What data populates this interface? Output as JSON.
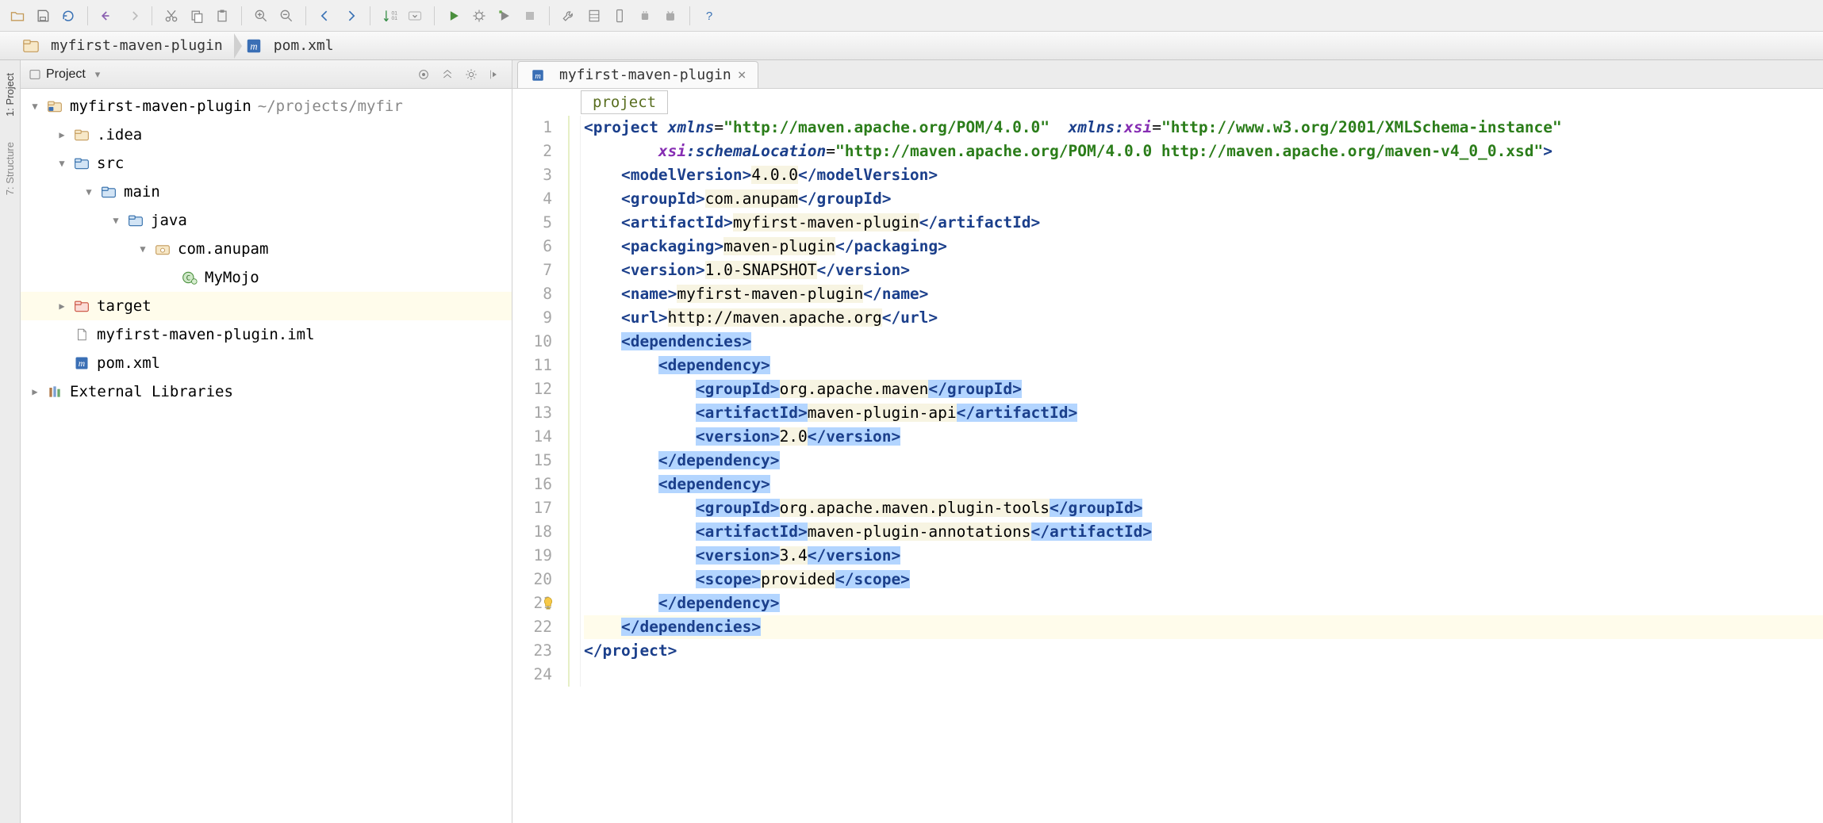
{
  "toolbar": {
    "buttons": [
      "open-folder",
      "save",
      "refresh",
      "",
      "undo",
      "redo",
      "",
      "cut",
      "copy",
      "paste",
      "",
      "zoom-in",
      "zoom-out",
      "",
      "back",
      "forward",
      "",
      "sort",
      "dropdown",
      "",
      "run",
      "debug",
      "coverage",
      "stop",
      "",
      "wrench",
      "db",
      "phone-v",
      "android-sm",
      "android",
      "",
      "help"
    ]
  },
  "breadcrumbs": [
    {
      "icon": "project-folder",
      "label": "myfirst-maven-plugin"
    },
    {
      "icon": "m-file",
      "label": "pom.xml"
    }
  ],
  "side_tabs": [
    {
      "label": "1: Project"
    },
    {
      "label": "7: Structure"
    }
  ],
  "project_panel": {
    "title": "Project",
    "header_buttons": [
      "target",
      "collapse",
      "gear",
      "locate"
    ],
    "tree": [
      {
        "depth": 0,
        "twisty": "down",
        "icon": "project-folder",
        "label": "myfirst-maven-plugin",
        "suffix": "~/projects/myfir"
      },
      {
        "depth": 1,
        "twisty": "right",
        "icon": "folder",
        "label": ".idea"
      },
      {
        "depth": 1,
        "twisty": "down",
        "icon": "folder-blue",
        "label": "src"
      },
      {
        "depth": 2,
        "twisty": "down",
        "icon": "folder-blue",
        "label": "main"
      },
      {
        "depth": 3,
        "twisty": "down",
        "icon": "folder-blue",
        "label": "java"
      },
      {
        "depth": 4,
        "twisty": "down",
        "icon": "package",
        "label": "com.anupam"
      },
      {
        "depth": 5,
        "twisty": "none",
        "icon": "class",
        "label": "MyMojo"
      },
      {
        "depth": 1,
        "twisty": "right",
        "icon": "folder-red",
        "label": "target",
        "hl": true
      },
      {
        "depth": 1,
        "twisty": "none",
        "icon": "file",
        "label": "myfirst-maven-plugin.iml"
      },
      {
        "depth": 1,
        "twisty": "none",
        "icon": "m-file",
        "label": "pom.xml"
      },
      {
        "depth": 0,
        "twisty": "right",
        "icon": "library",
        "label": "External Libraries"
      }
    ]
  },
  "editor": {
    "tab": {
      "icon": "m-file",
      "label": "myfirst-maven-plugin",
      "close": "×"
    },
    "crumb": "project",
    "bulb_line": 21,
    "current_line": 22,
    "lines": [
      {
        "n": 1,
        "indent": 0,
        "segs": [
          {
            "t": "<",
            "c": "tag"
          },
          {
            "t": "project ",
            "c": "tag"
          },
          {
            "t": "xmlns",
            "c": "attr"
          },
          {
            "t": "=",
            "c": "plain"
          },
          {
            "t": "\"http://maven.apache.org/POM/4.0.0\"",
            "c": "str"
          },
          {
            "t": "  ",
            "c": "plain"
          },
          {
            "t": "xmlns:",
            "c": "attr"
          },
          {
            "t": "xsi",
            "c": "ns"
          },
          {
            "t": "=",
            "c": "plain"
          },
          {
            "t": "\"http://www.w3.org/2001/XMLSchema-instance\"",
            "c": "str"
          }
        ]
      },
      {
        "n": 2,
        "indent": 2,
        "segs": [
          {
            "t": "xsi",
            "c": "ns"
          },
          {
            "t": ":",
            "c": "attr"
          },
          {
            "t": "schemaLocation",
            "c": "attr"
          },
          {
            "t": "=",
            "c": "plain"
          },
          {
            "t": "\"http://maven.apache.org/POM/4.0.0 http://maven.apache.org/maven-v4_0_0.xsd\"",
            "c": "str"
          },
          {
            "t": ">",
            "c": "tag"
          }
        ]
      },
      {
        "n": 3,
        "indent": 1,
        "segs": [
          {
            "t": "<modelVersion>",
            "c": "tag"
          },
          {
            "t": "4.0.0",
            "c": "text"
          },
          {
            "t": "</modelVersion>",
            "c": "tag"
          }
        ]
      },
      {
        "n": 4,
        "indent": 1,
        "segs": [
          {
            "t": "<groupId>",
            "c": "tag"
          },
          {
            "t": "com.anupam",
            "c": "text"
          },
          {
            "t": "</groupId>",
            "c": "tag"
          }
        ]
      },
      {
        "n": 5,
        "indent": 1,
        "segs": [
          {
            "t": "<artifactId>",
            "c": "tag"
          },
          {
            "t": "myfirst-maven-plugin",
            "c": "text"
          },
          {
            "t": "</artifactId>",
            "c": "tag"
          }
        ]
      },
      {
        "n": 6,
        "indent": 1,
        "segs": [
          {
            "t": "<packaging>",
            "c": "tag"
          },
          {
            "t": "maven-plugin",
            "c": "text"
          },
          {
            "t": "</packaging>",
            "c": "tag"
          }
        ]
      },
      {
        "n": 7,
        "indent": 1,
        "segs": [
          {
            "t": "<version>",
            "c": "tag"
          },
          {
            "t": "1.0-SNAPSHOT",
            "c": "text"
          },
          {
            "t": "</version>",
            "c": "tag"
          }
        ]
      },
      {
        "n": 8,
        "indent": 1,
        "segs": [
          {
            "t": "<name>",
            "c": "tag"
          },
          {
            "t": "myfirst-maven-plugin",
            "c": "text"
          },
          {
            "t": "</name>",
            "c": "tag"
          }
        ]
      },
      {
        "n": 9,
        "indent": 1,
        "segs": [
          {
            "t": "<url>",
            "c": "tag"
          },
          {
            "t": "http://maven.apache.org",
            "c": "text"
          },
          {
            "t": "</url>",
            "c": "tag"
          }
        ]
      },
      {
        "n": 10,
        "indent": 1,
        "sel": true,
        "segs": [
          {
            "t": "<dependencies>",
            "c": "tag"
          }
        ]
      },
      {
        "n": 11,
        "indent": 2,
        "sel": true,
        "segs": [
          {
            "t": "<dependency>",
            "c": "tag"
          }
        ]
      },
      {
        "n": 12,
        "indent": 3,
        "sel": true,
        "segs": [
          {
            "t": "<groupId>",
            "c": "tag"
          },
          {
            "t": "org.apache.maven",
            "c": "text"
          },
          {
            "t": "</groupId>",
            "c": "tag"
          }
        ]
      },
      {
        "n": 13,
        "indent": 3,
        "sel": true,
        "segs": [
          {
            "t": "<artifactId>",
            "c": "tag"
          },
          {
            "t": "maven-plugin-api",
            "c": "text"
          },
          {
            "t": "</artifactId>",
            "c": "tag"
          }
        ]
      },
      {
        "n": 14,
        "indent": 3,
        "sel": true,
        "segs": [
          {
            "t": "<version>",
            "c": "tag"
          },
          {
            "t": "2.0",
            "c": "text"
          },
          {
            "t": "</version>",
            "c": "tag"
          }
        ]
      },
      {
        "n": 15,
        "indent": 2,
        "sel": true,
        "segs": [
          {
            "t": "</dependency>",
            "c": "tag"
          }
        ]
      },
      {
        "n": 16,
        "indent": 2,
        "sel": true,
        "segs": [
          {
            "t": "<dependency>",
            "c": "tag"
          }
        ]
      },
      {
        "n": 17,
        "indent": 3,
        "sel": true,
        "segs": [
          {
            "t": "<groupId>",
            "c": "tag"
          },
          {
            "t": "org.apache.maven.plugin-tools",
            "c": "text"
          },
          {
            "t": "</groupId>",
            "c": "tag"
          }
        ]
      },
      {
        "n": 18,
        "indent": 3,
        "sel": true,
        "segs": [
          {
            "t": "<artifactId>",
            "c": "tag"
          },
          {
            "t": "maven-plugin-annotations",
            "c": "text"
          },
          {
            "t": "</artifactId>",
            "c": "tag"
          }
        ]
      },
      {
        "n": 19,
        "indent": 3,
        "sel": true,
        "segs": [
          {
            "t": "<version>",
            "c": "tag"
          },
          {
            "t": "3.4",
            "c": "text"
          },
          {
            "t": "</version>",
            "c": "tag"
          }
        ]
      },
      {
        "n": 20,
        "indent": 3,
        "sel": true,
        "segs": [
          {
            "t": "<scope>",
            "c": "tag"
          },
          {
            "t": "provided",
            "c": "text"
          },
          {
            "t": "</scope>",
            "c": "tag"
          }
        ]
      },
      {
        "n": 21,
        "indent": 2,
        "sel": true,
        "segs": [
          {
            "t": "</dependency>",
            "c": "tag"
          }
        ]
      },
      {
        "n": 22,
        "indent": 1,
        "sel": true,
        "segs": [
          {
            "t": "</dependencies>",
            "c": "tag"
          }
        ]
      },
      {
        "n": 23,
        "indent": 0,
        "segs": [
          {
            "t": "</project>",
            "c": "tag"
          }
        ]
      },
      {
        "n": 24,
        "indent": 0,
        "segs": []
      }
    ]
  }
}
